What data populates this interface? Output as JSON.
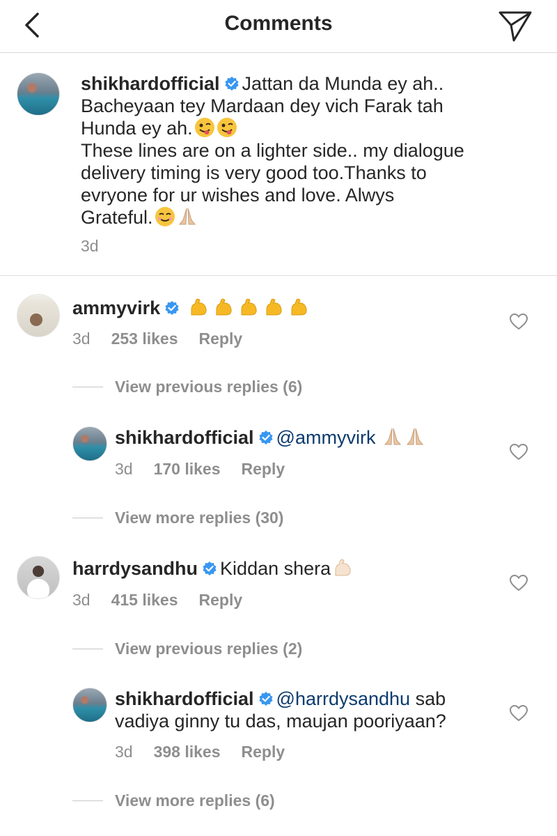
{
  "header": {
    "title": "Comments"
  },
  "caption": {
    "username": "shikhardofficial",
    "line1": "Jattan da Munda ey ah..",
    "line2": "Bacheyaan tey Mardaan dey vich Farak tah",
    "line3": "Hunda ey ah.",
    "line4": "These lines  are on a lighter side.. my dialogue",
    "line5": "delivery timing  is very good too.Thanks to",
    "line6": "evryone for ur wishes and love. Alwys",
    "line7": "Grateful.",
    "time": "3d"
  },
  "comments": [
    {
      "username": "ammyvirk",
      "text": "",
      "time": "3d",
      "likes": "253 likes",
      "reply": "Reply",
      "view_previous": "View previous replies (6)",
      "reply_item": {
        "username": "shikhardofficial",
        "mention": "@ammyvirk",
        "text": "",
        "time": "3d",
        "likes": "170 likes",
        "reply": "Reply"
      },
      "view_more": "View more replies (30)"
    },
    {
      "username": "harrdysandhu",
      "text": "Kiddan shera",
      "time": "3d",
      "likes": "415 likes",
      "reply": "Reply",
      "view_previous": "View previous replies (2)",
      "reply_item": {
        "username": "shikhardofficial",
        "mention": "@harrdysandhu",
        "text": "sab",
        "text_line2": "vadiya ginny tu das, maujan pooriyaan?",
        "time": "3d",
        "likes": "398 likes",
        "reply": "Reply"
      },
      "view_more": "View more replies (6)"
    }
  ],
  "colors": {
    "verified": "#3897f0",
    "muted": "#8e8e8e",
    "mention": "#0c3b6e"
  }
}
